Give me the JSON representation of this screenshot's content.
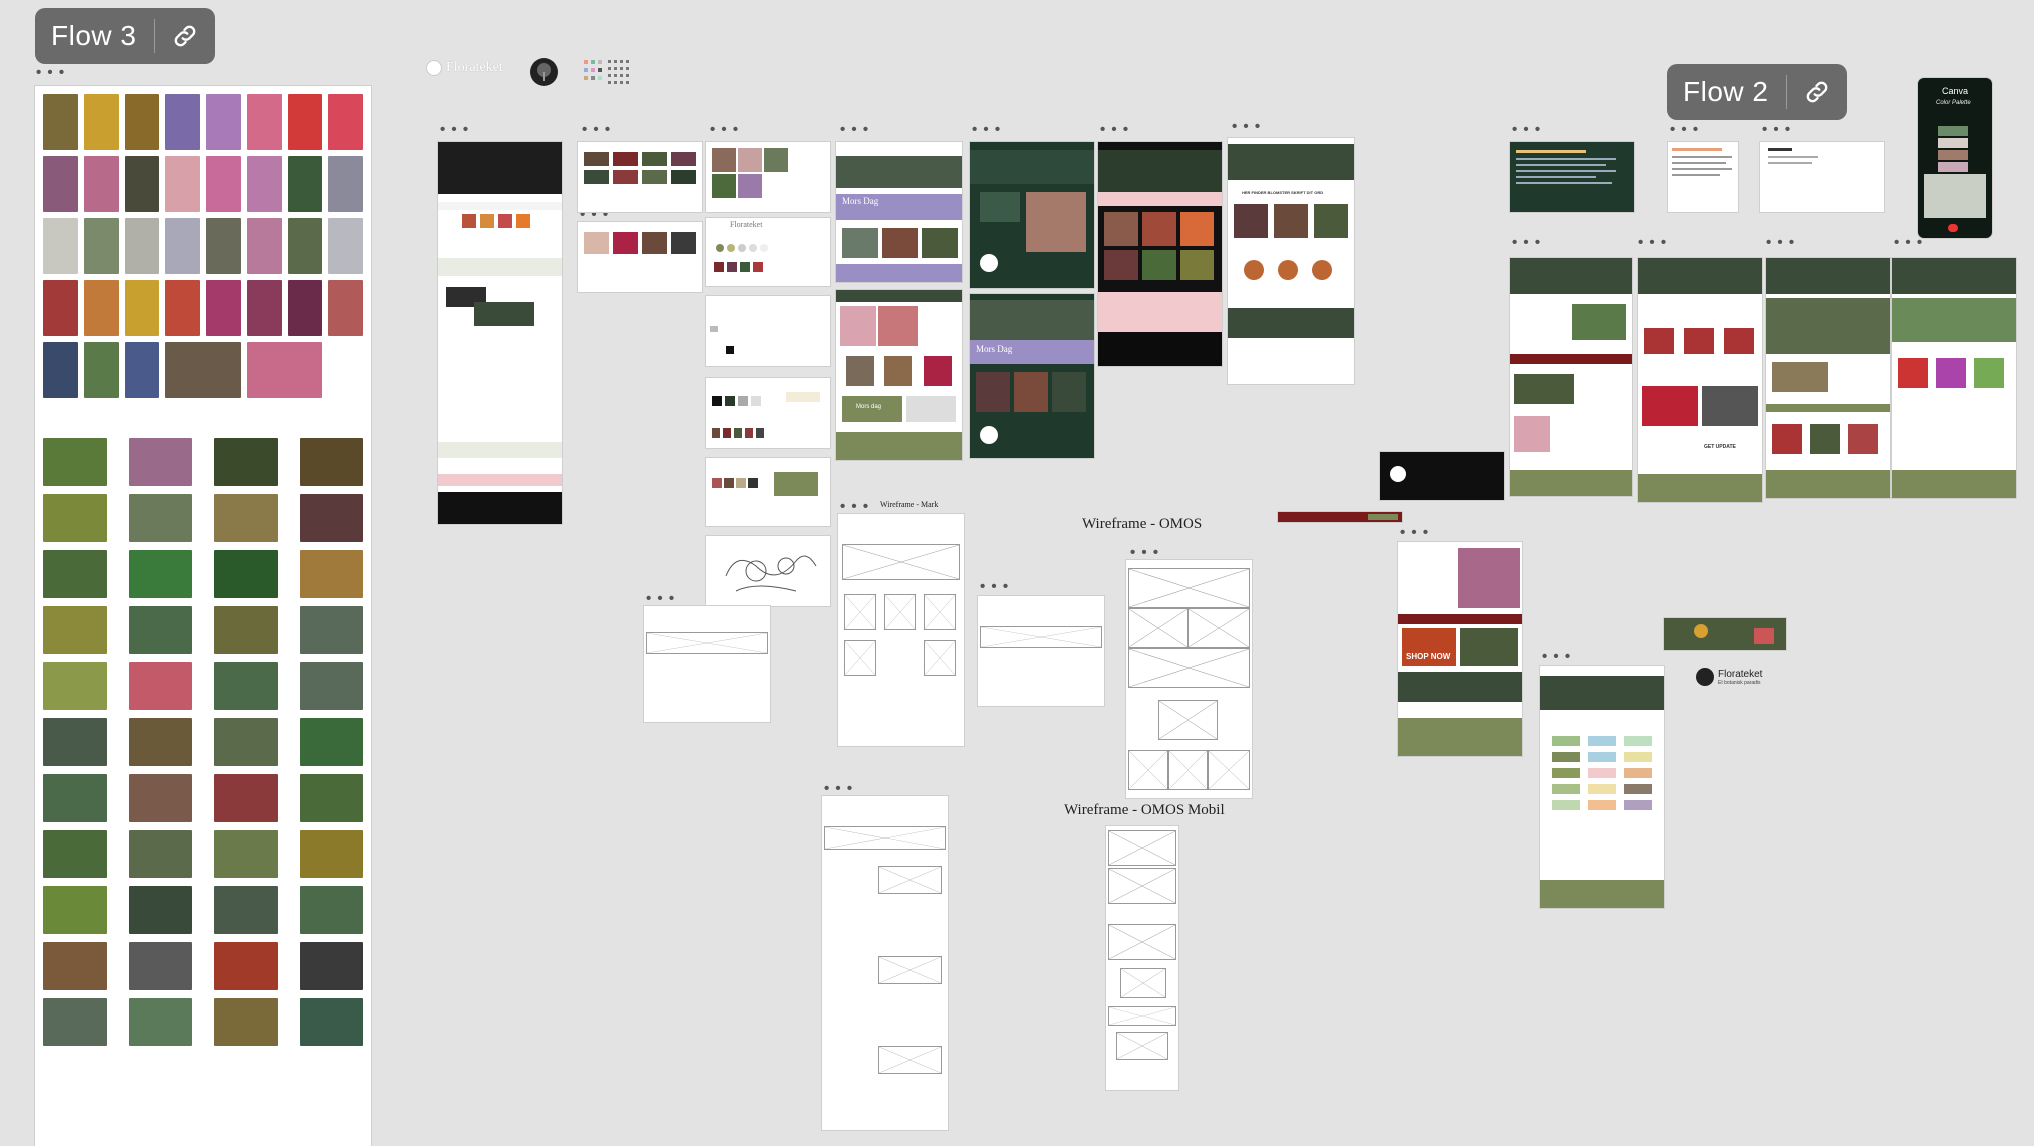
{
  "flows": [
    {
      "label": "Flow 3"
    },
    {
      "label": "Flow 2"
    }
  ],
  "icons": {
    "link": "link-icon",
    "more": "more-dots-icon"
  },
  "more_glyph": "• • •",
  "logo": {
    "name": "Florateket",
    "tagline": "Et botanisk paradis"
  },
  "captions": {
    "wireframe_main": "Wireframe - OMOS",
    "wireframe_mobile": "Wireframe - OMOS Mobil",
    "wireframe_mark": "Wireframe - Mark",
    "canva_title": "Canva",
    "canva_subtitle": "Color Palette",
    "mors_dag": "Mors Dag",
    "mors_dag_small": "Mors dag",
    "shop_now": "SHOP NOW",
    "get_updated": "GET UPDATE",
    "hero_heading": "HER FINDER BLOMSTER SKRIFT DIT ORD"
  },
  "colors": {
    "canvas": "#e3e3e3",
    "flow_badge": "#6a6a6a",
    "dark_green": "#1f3a2c",
    "olive": "#7c8a5a",
    "black": "#111111",
    "pink": "#f2c9cc",
    "lavender": "#9a8fc4"
  }
}
